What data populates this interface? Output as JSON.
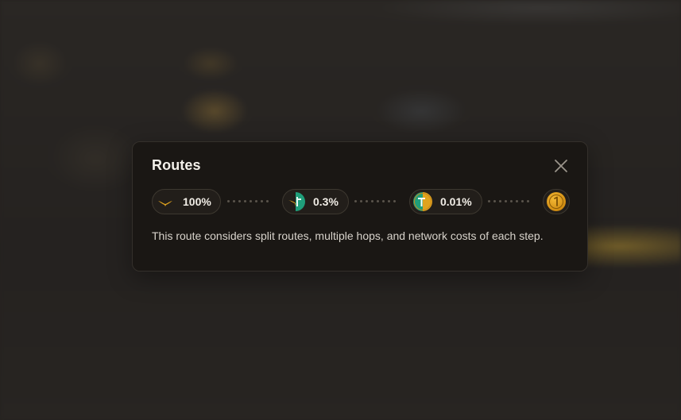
{
  "backdrop": {
    "description_hidden": true
  },
  "modal": {
    "title": "Routes",
    "close_label": "close-icon",
    "description": "This route considers split routes, multiple hops, and network costs of each step."
  },
  "route": {
    "hops": [
      {
        "token_icon": "bird-icon",
        "percent": "100%"
      },
      {
        "token_icon": "split-green-token-icon",
        "percent": "0.3%"
      },
      {
        "token_icon": "tether-gold-token-icon",
        "percent": "0.01%"
      },
      {
        "token_icon": "gold-coin-one-icon",
        "percent": ""
      }
    ]
  },
  "colors": {
    "modal_bg": "#1a1714",
    "accent_gold": "#e0a31e",
    "accent_green": "#1f9e7a",
    "text_primary": "#f3f0ea"
  }
}
